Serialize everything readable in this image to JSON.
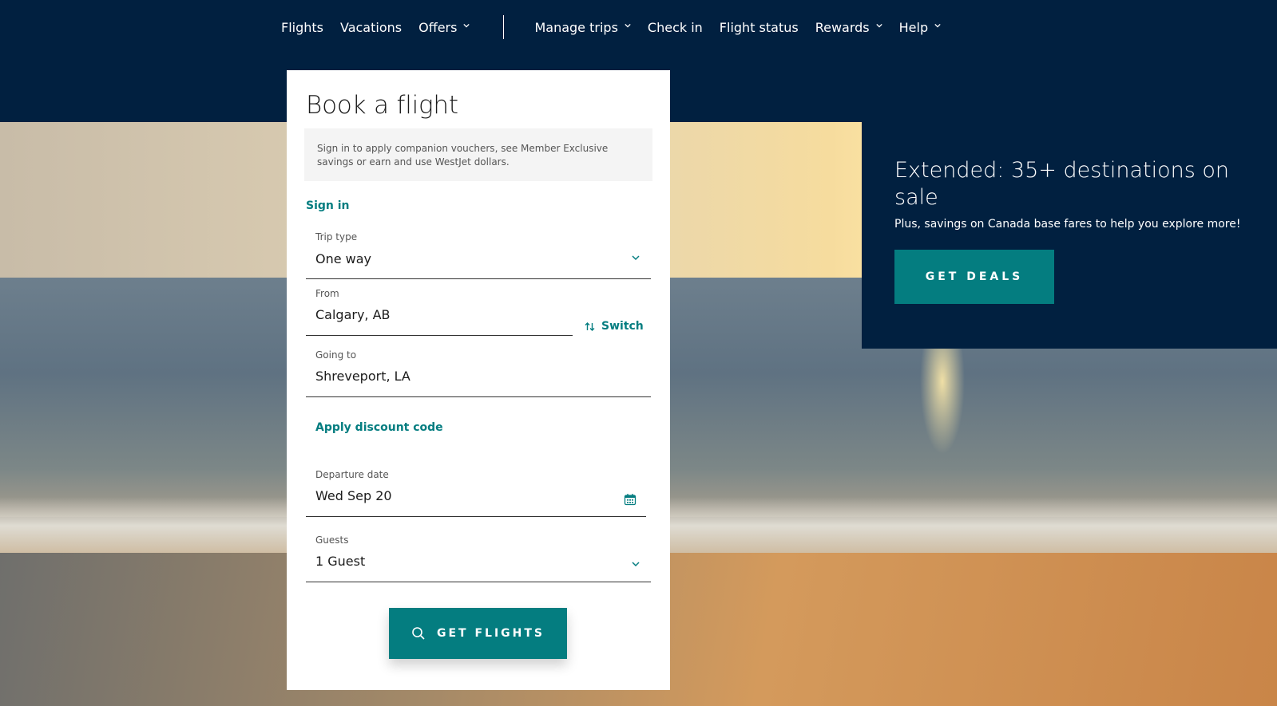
{
  "nav": {
    "items": [
      {
        "label": "Flights",
        "dropdown": false
      },
      {
        "label": "Vacations",
        "dropdown": false
      },
      {
        "label": "Offers",
        "dropdown": true
      }
    ],
    "items_right": [
      {
        "label": "Manage trips",
        "dropdown": true
      },
      {
        "label": "Check in",
        "dropdown": false
      },
      {
        "label": "Flight status",
        "dropdown": false
      },
      {
        "label": "Rewards",
        "dropdown": true
      },
      {
        "label": "Help",
        "dropdown": true
      }
    ]
  },
  "booking": {
    "title": "Book a flight",
    "notice": "Sign in to apply companion vouchers, see Member Exclusive savings or earn and use WestJet dollars.",
    "signin_label": "Sign in",
    "trip_type": {
      "label": "Trip type",
      "value": "One way"
    },
    "from": {
      "label": "From",
      "value": "Calgary, AB"
    },
    "switch_label": "Switch",
    "to": {
      "label": "Going to",
      "value": "Shreveport, LA"
    },
    "discount_label": "Apply discount code",
    "departure": {
      "label": "Departure date",
      "value": "Wed Sep 20"
    },
    "guests": {
      "label": "Guests",
      "value": "1 Guest"
    },
    "submit_label": "GET FLIGHTS"
  },
  "promo": {
    "title": "Extended: 35+ destinations on sale",
    "subtitle": "Plus, savings on Canada base fares to help you explore more!",
    "button_label": "GET DEALS"
  },
  "colors": {
    "navy": "#012040",
    "teal": "#047d80",
    "white": "#ffffff"
  }
}
